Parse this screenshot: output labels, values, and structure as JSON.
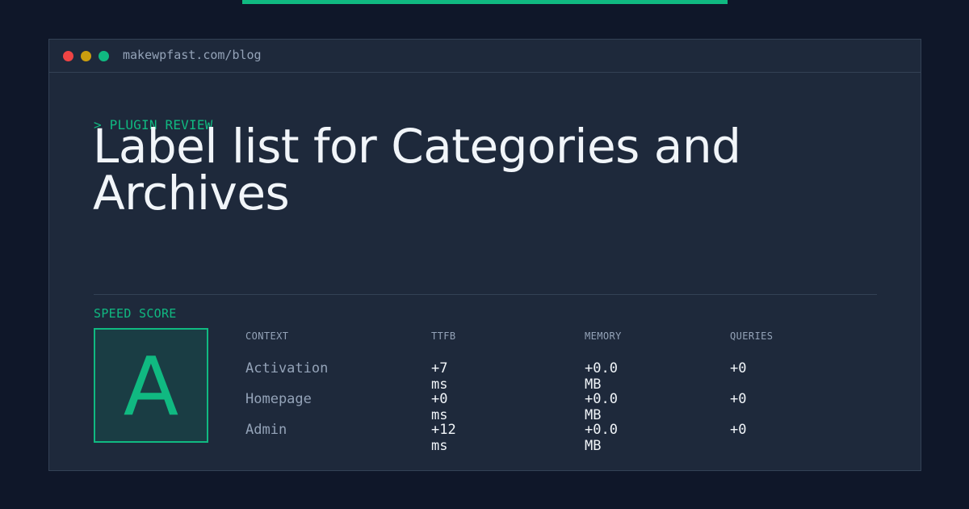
{
  "browser": {
    "url": "makewpfast.com/blog"
  },
  "hero": {
    "eyebrow": "> PLUGIN REVIEW",
    "title": "Label list for Categories and Archives"
  },
  "score": {
    "label": "SPEED SCORE",
    "grade": "A"
  },
  "table": {
    "headers": [
      "CONTEXT",
      "TTFB",
      "MEMORY",
      "QUERIES"
    ],
    "rows": [
      {
        "context": "Activation",
        "ttfb": "+7 ms",
        "memory": "+0.0 MB",
        "queries": "+0"
      },
      {
        "context": "Homepage",
        "ttfb": "+0 ms",
        "memory": "+0.0 MB",
        "queries": "+0"
      },
      {
        "context": "Admin",
        "ttfb": "+12 ms",
        "memory": "+0.0 MB",
        "queries": "+0"
      }
    ]
  },
  "colors": {
    "accent": "#10b981",
    "background": "#0f1729",
    "panel": "#1e293b",
    "text": "#f1f5f9",
    "muted": "#94a3b8"
  },
  "icons": [
    "close-dot-icon",
    "minimize-dot-icon",
    "maximize-dot-icon"
  ]
}
